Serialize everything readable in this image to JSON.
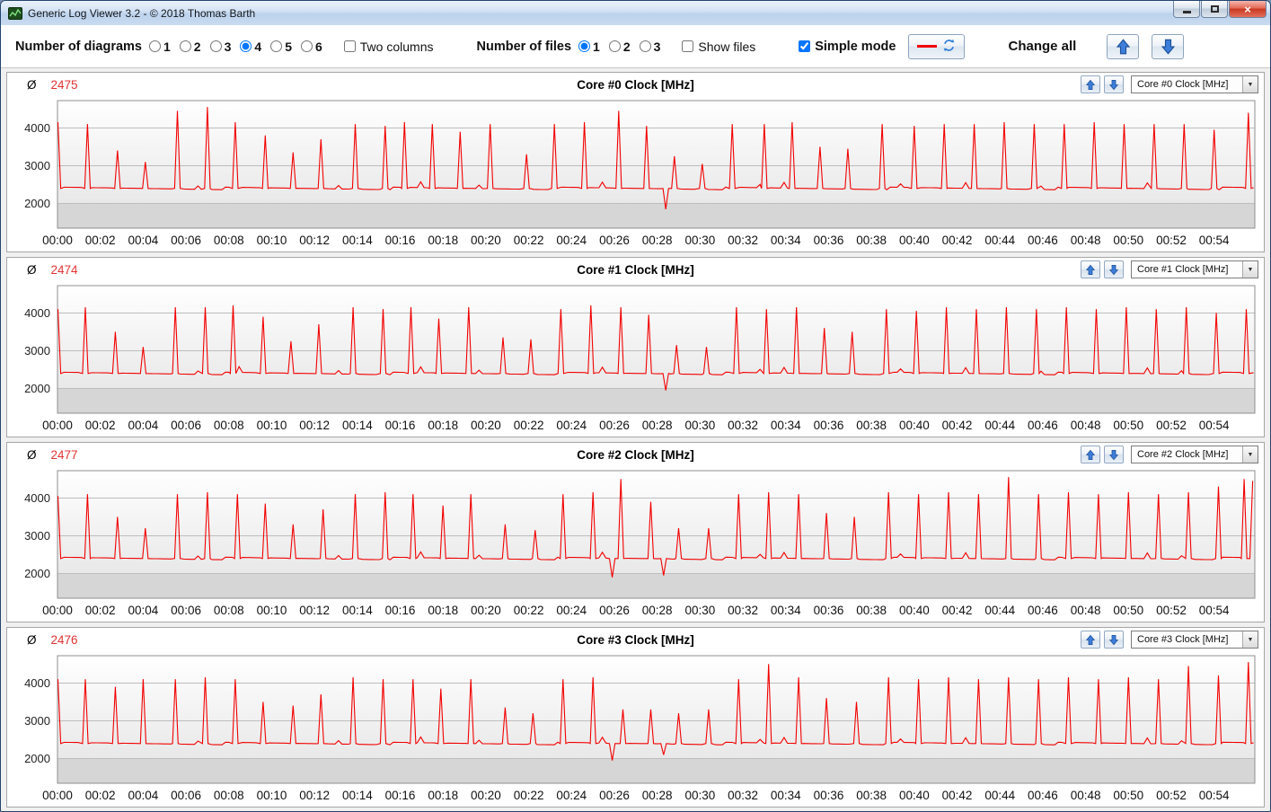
{
  "window": {
    "title": "Generic Log Viewer 3.2 - © 2018 Thomas Barth"
  },
  "toolbar": {
    "diagrams_label": "Number of diagrams",
    "diagram_options": [
      "1",
      "2",
      "3",
      "4",
      "5",
      "6"
    ],
    "diagrams_selected": "4",
    "two_columns_label": "Two columns",
    "two_columns_checked": false,
    "files_label": "Number of files",
    "file_options": [
      "1",
      "2",
      "3"
    ],
    "files_selected": "1",
    "show_files_label": "Show files",
    "show_files_checked": false,
    "simple_mode_label": "Simple mode",
    "simple_mode_checked": true,
    "change_all_label": "Change all"
  },
  "ui": {
    "avg_symbol": "Ø",
    "dropdown_arrow": "▼",
    "accent_blue": "#3d7edb",
    "line_red": "#f20000"
  },
  "chart_data": [
    {
      "type": "line",
      "title": "Core #0 Clock [MHz]",
      "average": "2475",
      "dropdown_value": "Core #0 Clock [MHz]",
      "color": "#f20000",
      "ylabel": "MHz",
      "y_ticks": [
        2000,
        3000,
        4000
      ],
      "ylim": [
        1350,
        4720
      ],
      "x_max": 55.9,
      "x_tick_step_min": 2,
      "x_tick_labels": [
        "00:00",
        "00:02",
        "00:04",
        "00:06",
        "00:08",
        "00:10",
        "00:12",
        "00:14",
        "00:16",
        "00:18",
        "00:20",
        "00:22",
        "00:24",
        "00:26",
        "00:28",
        "00:30",
        "00:32",
        "00:34",
        "00:36",
        "00:38",
        "00:40",
        "00:42",
        "00:44",
        "00:46",
        "00:48",
        "00:50",
        "00:52",
        "00:54"
      ],
      "baseline": 2400,
      "spikes": [
        [
          0.02,
          4150
        ],
        [
          1.4,
          4100
        ],
        [
          2.8,
          3400
        ],
        [
          4.1,
          3100
        ],
        [
          5.6,
          4450
        ],
        [
          7.0,
          4550
        ],
        [
          8.3,
          4150
        ],
        [
          9.7,
          3800
        ],
        [
          11.0,
          3350
        ],
        [
          12.3,
          3700
        ],
        [
          13.9,
          4100
        ],
        [
          15.3,
          4050
        ],
        [
          16.2,
          4150
        ],
        [
          17.5,
          4100
        ],
        [
          18.8,
          3900
        ],
        [
          20.2,
          4100
        ],
        [
          21.9,
          3300
        ],
        [
          23.2,
          4100
        ],
        [
          24.6,
          4150
        ],
        [
          26.2,
          4450
        ],
        [
          27.5,
          4050
        ],
        [
          28.8,
          3250
        ],
        [
          30.1,
          3050
        ],
        [
          31.5,
          4100
        ],
        [
          33.0,
          4100
        ],
        [
          34.3,
          4150
        ],
        [
          35.6,
          3500
        ],
        [
          36.9,
          3450
        ],
        [
          38.5,
          4100
        ],
        [
          40.0,
          4050
        ],
        [
          41.4,
          4100
        ],
        [
          42.8,
          4100
        ],
        [
          44.2,
          4150
        ],
        [
          45.6,
          4100
        ],
        [
          47.0,
          4100
        ],
        [
          48.4,
          4150
        ],
        [
          49.8,
          4100
        ],
        [
          51.2,
          4100
        ],
        [
          52.6,
          4100
        ],
        [
          54.0,
          3950
        ],
        [
          55.6,
          4400
        ]
      ],
      "dips": [
        [
          28.4,
          1850
        ]
      ]
    },
    {
      "type": "line",
      "title": "Core #1 Clock [MHz]",
      "average": "2474",
      "dropdown_value": "Core #1 Clock [MHz]",
      "color": "#f20000",
      "ylabel": "MHz",
      "y_ticks": [
        2000,
        3000,
        4000
      ],
      "ylim": [
        1350,
        4720
      ],
      "x_max": 55.9,
      "x_tick_step_min": 2,
      "x_tick_labels": [
        "00:00",
        "00:02",
        "00:04",
        "00:06",
        "00:08",
        "00:10",
        "00:12",
        "00:14",
        "00:16",
        "00:18",
        "00:20",
        "00:22",
        "00:24",
        "00:26",
        "00:28",
        "00:30",
        "00:32",
        "00:34",
        "00:36",
        "00:38",
        "00:40",
        "00:42",
        "00:44",
        "00:46",
        "00:48",
        "00:50",
        "00:52",
        "00:54"
      ],
      "baseline": 2400,
      "spikes": [
        [
          0.02,
          4100
        ],
        [
          1.3,
          4150
        ],
        [
          2.7,
          3500
        ],
        [
          4.0,
          3100
        ],
        [
          5.5,
          4150
        ],
        [
          6.9,
          4150
        ],
        [
          8.2,
          4200
        ],
        [
          9.6,
          3900
        ],
        [
          10.9,
          3250
        ],
        [
          12.2,
          3700
        ],
        [
          13.8,
          4150
        ],
        [
          15.2,
          4100
        ],
        [
          16.5,
          4150
        ],
        [
          17.8,
          3850
        ],
        [
          19.2,
          4150
        ],
        [
          20.8,
          3350
        ],
        [
          22.1,
          3300
        ],
        [
          23.5,
          4100
        ],
        [
          24.9,
          4200
        ],
        [
          26.3,
          4150
        ],
        [
          27.6,
          3950
        ],
        [
          28.9,
          3150
        ],
        [
          30.3,
          3100
        ],
        [
          31.7,
          4150
        ],
        [
          33.1,
          4100
        ],
        [
          34.5,
          4150
        ],
        [
          35.8,
          3600
        ],
        [
          37.1,
          3500
        ],
        [
          38.7,
          4100
        ],
        [
          40.1,
          4050
        ],
        [
          41.5,
          4150
        ],
        [
          42.9,
          4100
        ],
        [
          44.3,
          4150
        ],
        [
          45.7,
          4100
        ],
        [
          47.1,
          4150
        ],
        [
          48.5,
          4100
        ],
        [
          49.9,
          4150
        ],
        [
          51.3,
          4100
        ],
        [
          52.7,
          4150
        ],
        [
          54.1,
          4000
        ],
        [
          55.5,
          4100
        ]
      ],
      "dips": [
        [
          28.4,
          1950
        ]
      ]
    },
    {
      "type": "line",
      "title": "Core #2 Clock [MHz]",
      "average": "2477",
      "dropdown_value": "Core #2 Clock [MHz]",
      "color": "#f20000",
      "ylabel": "MHz",
      "y_ticks": [
        2000,
        3000,
        4000
      ],
      "ylim": [
        1350,
        4720
      ],
      "x_max": 55.9,
      "x_tick_step_min": 2,
      "x_tick_labels": [
        "00:00",
        "00:02",
        "00:04",
        "00:06",
        "00:08",
        "00:10",
        "00:12",
        "00:14",
        "00:16",
        "00:18",
        "00:20",
        "00:22",
        "00:24",
        "00:26",
        "00:28",
        "00:30",
        "00:32",
        "00:34",
        "00:36",
        "00:38",
        "00:40",
        "00:42",
        "00:44",
        "00:46",
        "00:48",
        "00:50",
        "00:52",
        "00:54"
      ],
      "baseline": 2400,
      "spikes": [
        [
          0.02,
          4050
        ],
        [
          1.4,
          4100
        ],
        [
          2.8,
          3500
        ],
        [
          4.1,
          3200
        ],
        [
          5.6,
          4100
        ],
        [
          7.0,
          4150
        ],
        [
          8.4,
          4100
        ],
        [
          9.7,
          3850
        ],
        [
          11.0,
          3300
        ],
        [
          12.4,
          3700
        ],
        [
          13.9,
          4100
        ],
        [
          15.3,
          4150
        ],
        [
          16.6,
          4100
        ],
        [
          18.0,
          3800
        ],
        [
          19.3,
          4100
        ],
        [
          20.9,
          3300
        ],
        [
          22.3,
          3150
        ],
        [
          23.6,
          4100
        ],
        [
          25.0,
          4150
        ],
        [
          26.3,
          4500
        ],
        [
          27.7,
          3900
        ],
        [
          29.0,
          3200
        ],
        [
          30.4,
          3200
        ],
        [
          31.8,
          4100
        ],
        [
          33.2,
          4150
        ],
        [
          34.6,
          4100
        ],
        [
          35.9,
          3600
        ],
        [
          37.2,
          3500
        ],
        [
          38.8,
          4150
        ],
        [
          40.2,
          4100
        ],
        [
          41.6,
          4150
        ],
        [
          43.0,
          4100
        ],
        [
          44.4,
          4550
        ],
        [
          45.8,
          4100
        ],
        [
          47.2,
          4150
        ],
        [
          48.6,
          4100
        ],
        [
          50.0,
          4150
        ],
        [
          51.4,
          4100
        ],
        [
          52.8,
          4150
        ],
        [
          54.2,
          4300
        ],
        [
          55.4,
          4500
        ],
        [
          55.8,
          4450
        ]
      ],
      "dips": [
        [
          25.9,
          1900
        ],
        [
          28.3,
          1950
        ]
      ]
    },
    {
      "type": "line",
      "title": "Core #3 Clock [MHz]",
      "average": "2476",
      "dropdown_value": "Core #3 Clock [MHz]",
      "color": "#f20000",
      "ylabel": "MHz",
      "y_ticks": [
        2000,
        3000,
        4000
      ],
      "ylim": [
        1350,
        4720
      ],
      "x_max": 55.9,
      "x_tick_step_min": 2,
      "x_tick_labels": [
        "00:00",
        "00:02",
        "00:04",
        "00:06",
        "00:08",
        "00:10",
        "00:12",
        "00:14",
        "00:16",
        "00:18",
        "00:20",
        "00:22",
        "00:24",
        "00:26",
        "00:28",
        "00:30",
        "00:32",
        "00:34",
        "00:36",
        "00:38",
        "00:40",
        "00:42",
        "00:44",
        "00:46",
        "00:48",
        "00:50",
        "00:52",
        "00:54"
      ],
      "baseline": 2400,
      "spikes": [
        [
          0.02,
          4100
        ],
        [
          1.3,
          4100
        ],
        [
          2.7,
          3900
        ],
        [
          4.0,
          4100
        ],
        [
          5.5,
          4100
        ],
        [
          6.9,
          4150
        ],
        [
          8.3,
          4100
        ],
        [
          9.6,
          3500
        ],
        [
          11.0,
          3400
        ],
        [
          12.3,
          3700
        ],
        [
          13.8,
          4150
        ],
        [
          15.2,
          4100
        ],
        [
          16.6,
          4100
        ],
        [
          17.9,
          3850
        ],
        [
          19.3,
          4100
        ],
        [
          20.9,
          3350
        ],
        [
          22.2,
          3200
        ],
        [
          23.6,
          4100
        ],
        [
          25.0,
          4150
        ],
        [
          26.4,
          3300
        ],
        [
          27.7,
          3300
        ],
        [
          29.0,
          3200
        ],
        [
          30.4,
          3300
        ],
        [
          31.8,
          4100
        ],
        [
          33.2,
          4500
        ],
        [
          34.6,
          4150
        ],
        [
          35.9,
          3600
        ],
        [
          37.3,
          3500
        ],
        [
          38.8,
          4150
        ],
        [
          40.2,
          4100
        ],
        [
          41.6,
          4150
        ],
        [
          43.0,
          4100
        ],
        [
          44.4,
          4150
        ],
        [
          45.8,
          4100
        ],
        [
          47.2,
          4150
        ],
        [
          48.6,
          4100
        ],
        [
          50.0,
          4150
        ],
        [
          51.4,
          4100
        ],
        [
          52.8,
          4450
        ],
        [
          54.2,
          4200
        ],
        [
          55.6,
          4550
        ]
      ],
      "dips": [
        [
          25.9,
          1950
        ],
        [
          28.3,
          2100
        ]
      ]
    }
  ]
}
